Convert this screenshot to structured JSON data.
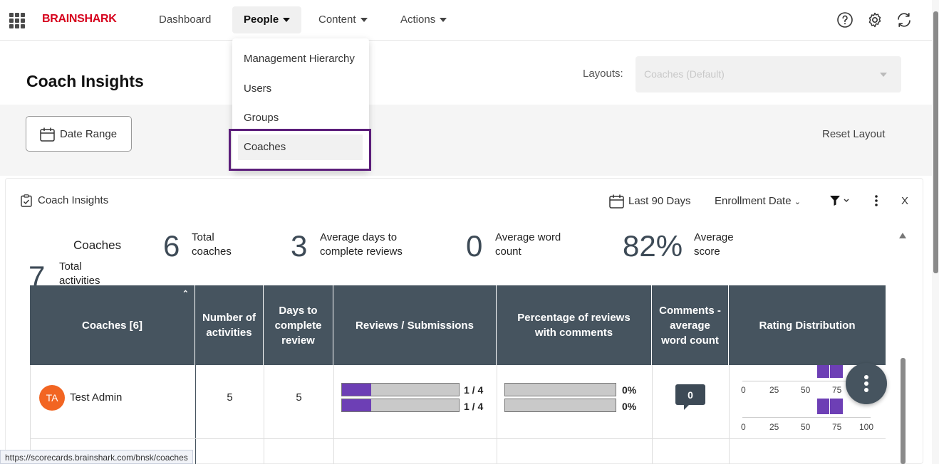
{
  "nav": {
    "brand": "BRAINSHARK",
    "items": [
      {
        "label": "Dashboard"
      },
      {
        "label": "People"
      },
      {
        "label": "Content"
      },
      {
        "label": "Actions"
      }
    ],
    "icons": [
      "help-icon",
      "settings-gear-icon",
      "sync-icon"
    ]
  },
  "people_menu": {
    "items": [
      "Management Hierarchy",
      "Users",
      "Groups",
      "Coaches"
    ],
    "highlighted": "Coaches"
  },
  "header": {
    "title": "Coach Insights",
    "layouts_label": "Layouts:",
    "layouts_value": "Coaches (Default)"
  },
  "toolbar": {
    "date_range": "Date Range",
    "reset_layout": "Reset Layout"
  },
  "card": {
    "title": "Coach Insights",
    "period": "Last 90 Days",
    "date_field": "Enrollment Date",
    "close": "X"
  },
  "stats": {
    "coaches_label": "Coaches",
    "total_coaches": "6",
    "total_coaches_label_1": "Total",
    "total_coaches_label_2": "coaches",
    "total_activities": "7",
    "total_activities_label_1": "Total",
    "total_activities_label_2": "activities",
    "avg_days": "3",
    "avg_days_label_1": "Average days to",
    "avg_days_label_2": "complete reviews",
    "avg_words": "0",
    "avg_words_label_1": "Average word",
    "avg_words_label_2": "count",
    "avg_score": "82%",
    "avg_score_label_1": "Average",
    "avg_score_label_2": "score"
  },
  "table": {
    "headers": {
      "coaches": "Coaches [6]",
      "activities": "Number of activities",
      "days": "Days to complete review",
      "reviews": "Reviews / Submissions",
      "pct_comments": "Percentage of reviews with comments",
      "comments_avg": "Comments - average word count",
      "rating": "Rating Distribution"
    },
    "rows": [
      {
        "initials": "TA",
        "name": "Test Admin",
        "activities": "5",
        "days": "5",
        "reviews": [
          {
            "label": "1 / 4",
            "fraction": 0.25
          },
          {
            "label": "1 / 4",
            "fraction": 0.25
          }
        ],
        "pct_comments": [
          {
            "label": "0%",
            "fraction": 0
          },
          {
            "label": "0%",
            "fraction": 0
          }
        ],
        "comment_count": "0",
        "rating_axis": [
          "0",
          "25",
          "50",
          "75",
          "100"
        ]
      }
    ]
  },
  "status_url": "https://scorecards.brainshark.com/bnsk/coaches",
  "colors": {
    "brand": "#d6001c",
    "header_bg": "#46545f",
    "bar_fill": "#6d3fb5",
    "avatar": "#f26522",
    "menu_outline": "#5b1d7a"
  }
}
